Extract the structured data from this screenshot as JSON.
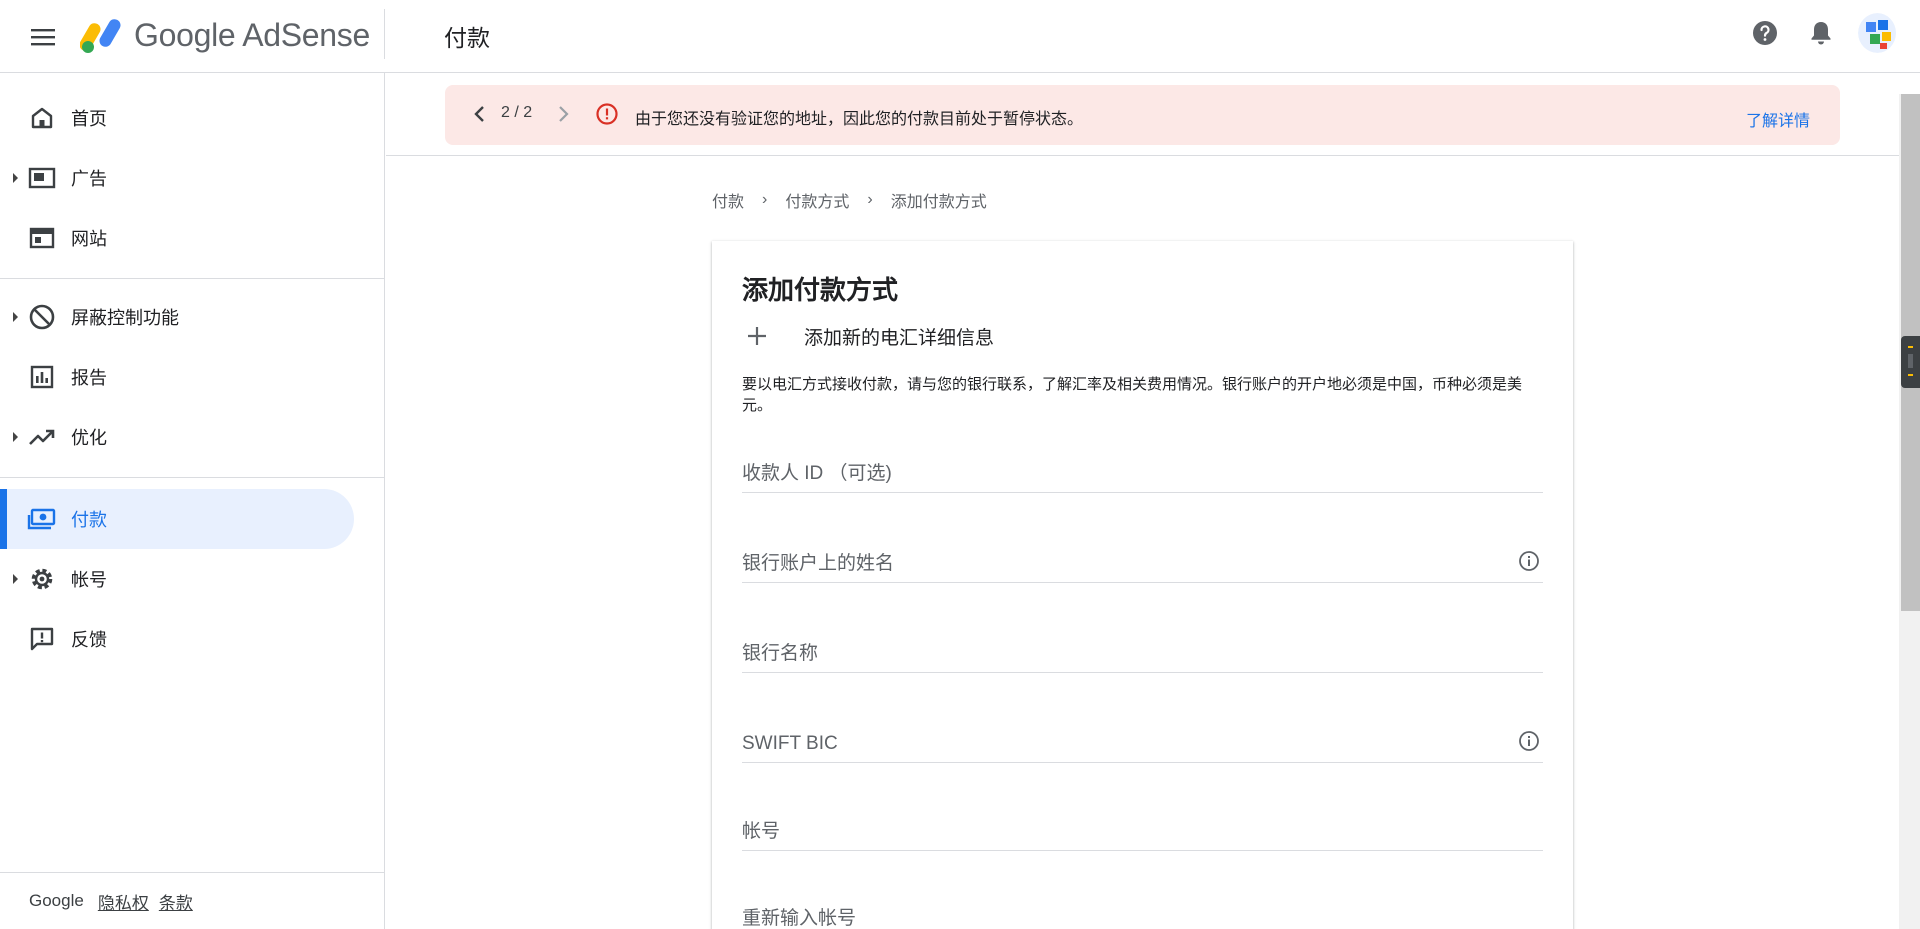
{
  "header": {
    "brand": "Google AdSense",
    "page_title": "付款"
  },
  "sidebar": {
    "items": [
      {
        "label": "首页",
        "icon": "home-icon"
      },
      {
        "label": "广告",
        "icon": "ads-icon",
        "expandable": true
      },
      {
        "label": "网站",
        "icon": "sites-icon"
      },
      {
        "label": "屏蔽控制功能",
        "icon": "block-icon",
        "expandable": true
      },
      {
        "label": "报告",
        "icon": "reports-icon"
      },
      {
        "label": "优化",
        "icon": "optimize-icon",
        "expandable": true
      },
      {
        "label": "付款",
        "icon": "payments-icon",
        "active": true
      },
      {
        "label": "帐号",
        "icon": "account-gear-icon",
        "expandable": true
      },
      {
        "label": "反馈",
        "icon": "feedback-icon"
      }
    ],
    "footer": {
      "brand": "Google",
      "privacy": "隐私权",
      "terms": "条款"
    }
  },
  "alert": {
    "counter": "2 / 2",
    "message": "由于您还没有验证您的地址，因此您的付款目前处于暂停状态。",
    "link": "了解详情",
    "color": "#fce8e6"
  },
  "breadcrumb": [
    "付款",
    "付款方式",
    "添加付款方式"
  ],
  "form": {
    "title": "添加付款方式",
    "add_label": "添加新的电汇详细信息",
    "description": "要以电汇方式接收付款，请与您的银行联系，了解汇率及相关费用情况。银行账户的开户地必须是中国，币种必须是美元。",
    "fields": [
      {
        "label": "收款人 ID （可选)",
        "info": false
      },
      {
        "label": "银行账户上的姓名",
        "info": true
      },
      {
        "label": "银行名称",
        "info": false
      },
      {
        "label": "SWIFT BIC",
        "info": true
      },
      {
        "label": "帐号",
        "info": false
      },
      {
        "label": "重新输入帐号",
        "info": false
      }
    ]
  },
  "colors": {
    "accent": "#1a73e8",
    "active_bg": "#e8f0fe",
    "alert_icon": "#d93025"
  }
}
